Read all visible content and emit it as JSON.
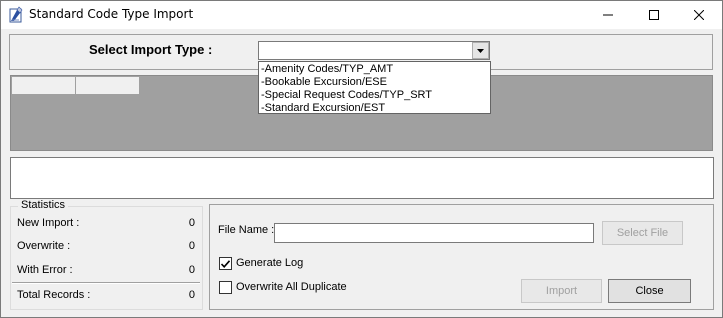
{
  "window": {
    "title": "Standard Code Type Import"
  },
  "import": {
    "label": "Select Import Type :",
    "selected": "",
    "options": [
      "-Amenity Codes/TYP_AMT",
      "-Bookable Excursion/ESE",
      "-Special Request Codes/TYP_SRT",
      "-Standard Excursion/EST"
    ]
  },
  "statistics": {
    "legend": "Statistics",
    "new_import_label": "New Import :",
    "new_import_value": "0",
    "overwrite_label": "Overwrite :",
    "overwrite_value": "0",
    "with_error_label": "With Error :",
    "with_error_value": "0",
    "total_label": "Total Records :",
    "total_value": "0"
  },
  "file": {
    "label": "File Name :",
    "value": "",
    "select_label": "Select File"
  },
  "options": {
    "generate_log_label": "Generate Log",
    "generate_log_checked": true,
    "overwrite_dup_label": "Overwrite All Duplicate",
    "overwrite_dup_checked": false
  },
  "actions": {
    "import_label": "Import",
    "close_label": "Close"
  },
  "icons": {
    "app": "import-app-icon",
    "minimize": "minimize-icon",
    "maximize": "maximize-icon",
    "close": "close-icon",
    "dropdown": "chevron-down-icon",
    "check": "checkmark-icon"
  }
}
